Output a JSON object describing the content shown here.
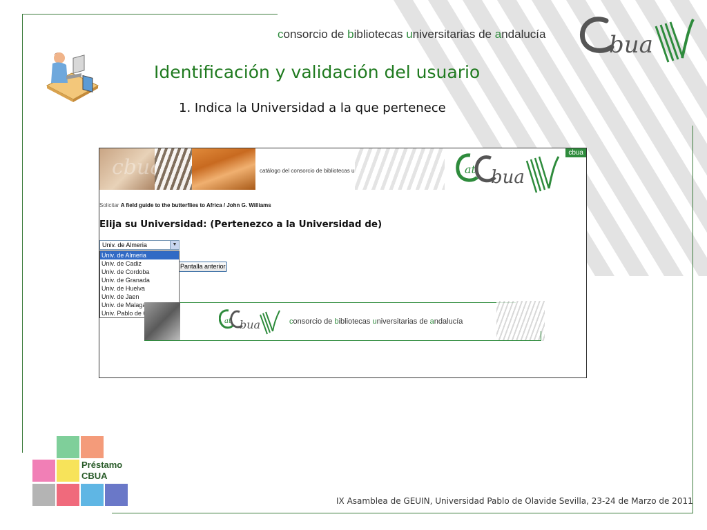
{
  "header": {
    "consorcio_parts": [
      {
        "text": "c",
        "hl": true
      },
      {
        "text": "onsorcio de ",
        "hl": false
      },
      {
        "text": "b",
        "hl": true
      },
      {
        "text": "ibliotecas ",
        "hl": false
      },
      {
        "text": "u",
        "hl": true
      },
      {
        "text": "niversitarias de ",
        "hl": false
      },
      {
        "text": "a",
        "hl": true
      },
      {
        "text": "ndalucía",
        "hl": false
      }
    ],
    "logo_text": "CBUA"
  },
  "slide": {
    "title": "Identificación y validación del usuario",
    "step": "1. Indica la Universidad a la que pertenece"
  },
  "screenshot": {
    "banner_cursive": "cbua",
    "banner_text": "catálogo del consorcio de bibliotecas universitarias de andalucía",
    "cbua_tag": "cbua",
    "solicitar_label": "Solicitar",
    "solicitar_title": "A field guide to the butterflies to Africa / John G. Williams",
    "heading": "Elija su Universidad: (Pertenezco a la Universidad de)",
    "select_value": "Univ. de Almeria",
    "select_options": [
      "Univ. de Almeria",
      "Univ. de Cadiz",
      "Univ. de Cordoba",
      "Univ. de Granada",
      "Univ. de Huelva",
      "Univ. de Jaen",
      "Univ. de Malaga",
      "Univ. Pablo de Olavide"
    ],
    "back_button": "Pantalla anterior",
    "footer_parts": [
      {
        "text": "c",
        "hl": true
      },
      {
        "text": "onsorcio de ",
        "hl": false
      },
      {
        "text": "b",
        "hl": true
      },
      {
        "text": "ibliotecas ",
        "hl": false
      },
      {
        "text": "u",
        "hl": true
      },
      {
        "text": "niversitarias de ",
        "hl": false
      },
      {
        "text": "a",
        "hl": true
      },
      {
        "text": "ndalucía",
        "hl": false
      }
    ]
  },
  "prestamo": {
    "line1": "Préstamo",
    "line2": "CBUA"
  },
  "footer": {
    "text": "IX Asamblea de GEUIN, Universidad Pablo de Olavide Sevilla, 23-24 de Marzo de 2011"
  },
  "colors": {
    "accent_green": "#2e8b3c",
    "title_green": "#1f7a1f",
    "squares": [
      "#7fcf9a",
      "#f49b7a",
      "#f17fb6",
      "#f7e35a",
      "#b4b4b4",
      "#f06a7c",
      "#5fb6e4",
      "#6a78c8"
    ]
  }
}
